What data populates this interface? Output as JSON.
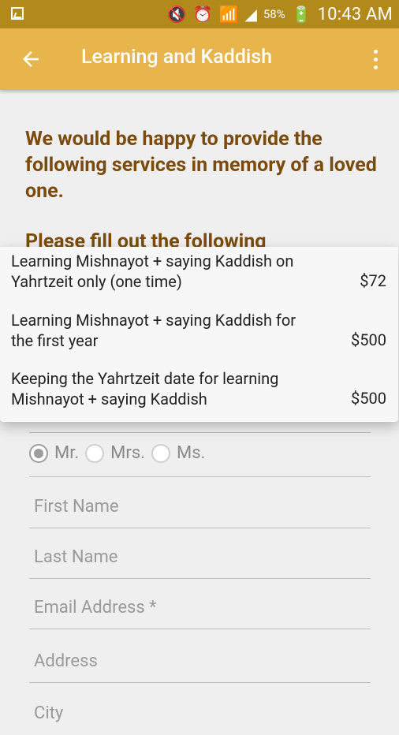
{
  "status_bar": {
    "battery_text": "58%",
    "time": "10:43 AM"
  },
  "app_bar": {
    "title": "Learning and Kaddish"
  },
  "intro": {
    "lines": [
      "We would be happy to provide the following services in memory of a loved one."
    ],
    "partial_heading": "Please fill out the following"
  },
  "dropdown": {
    "items": [
      {
        "text": "Learning Mishnayot + saying Kaddish on Yahrtzeit only (one time)",
        "price": "$72"
      },
      {
        "text": "Learning Mishnayot + saying Kaddish for the first year",
        "price": "$500"
      },
      {
        "text": "Keeping the Yahrtzeit date for learning Mishnayot + saying Kaddish",
        "price": "$500"
      }
    ]
  },
  "form": {
    "title_options": [
      {
        "label": "Mr."
      },
      {
        "label": "Mrs."
      },
      {
        "label": "Ms."
      }
    ],
    "fields": [
      {
        "placeholder": "First Name"
      },
      {
        "placeholder": "Last Name"
      },
      {
        "placeholder": "Email Address *"
      },
      {
        "placeholder": "Address"
      },
      {
        "placeholder": "City"
      }
    ]
  }
}
